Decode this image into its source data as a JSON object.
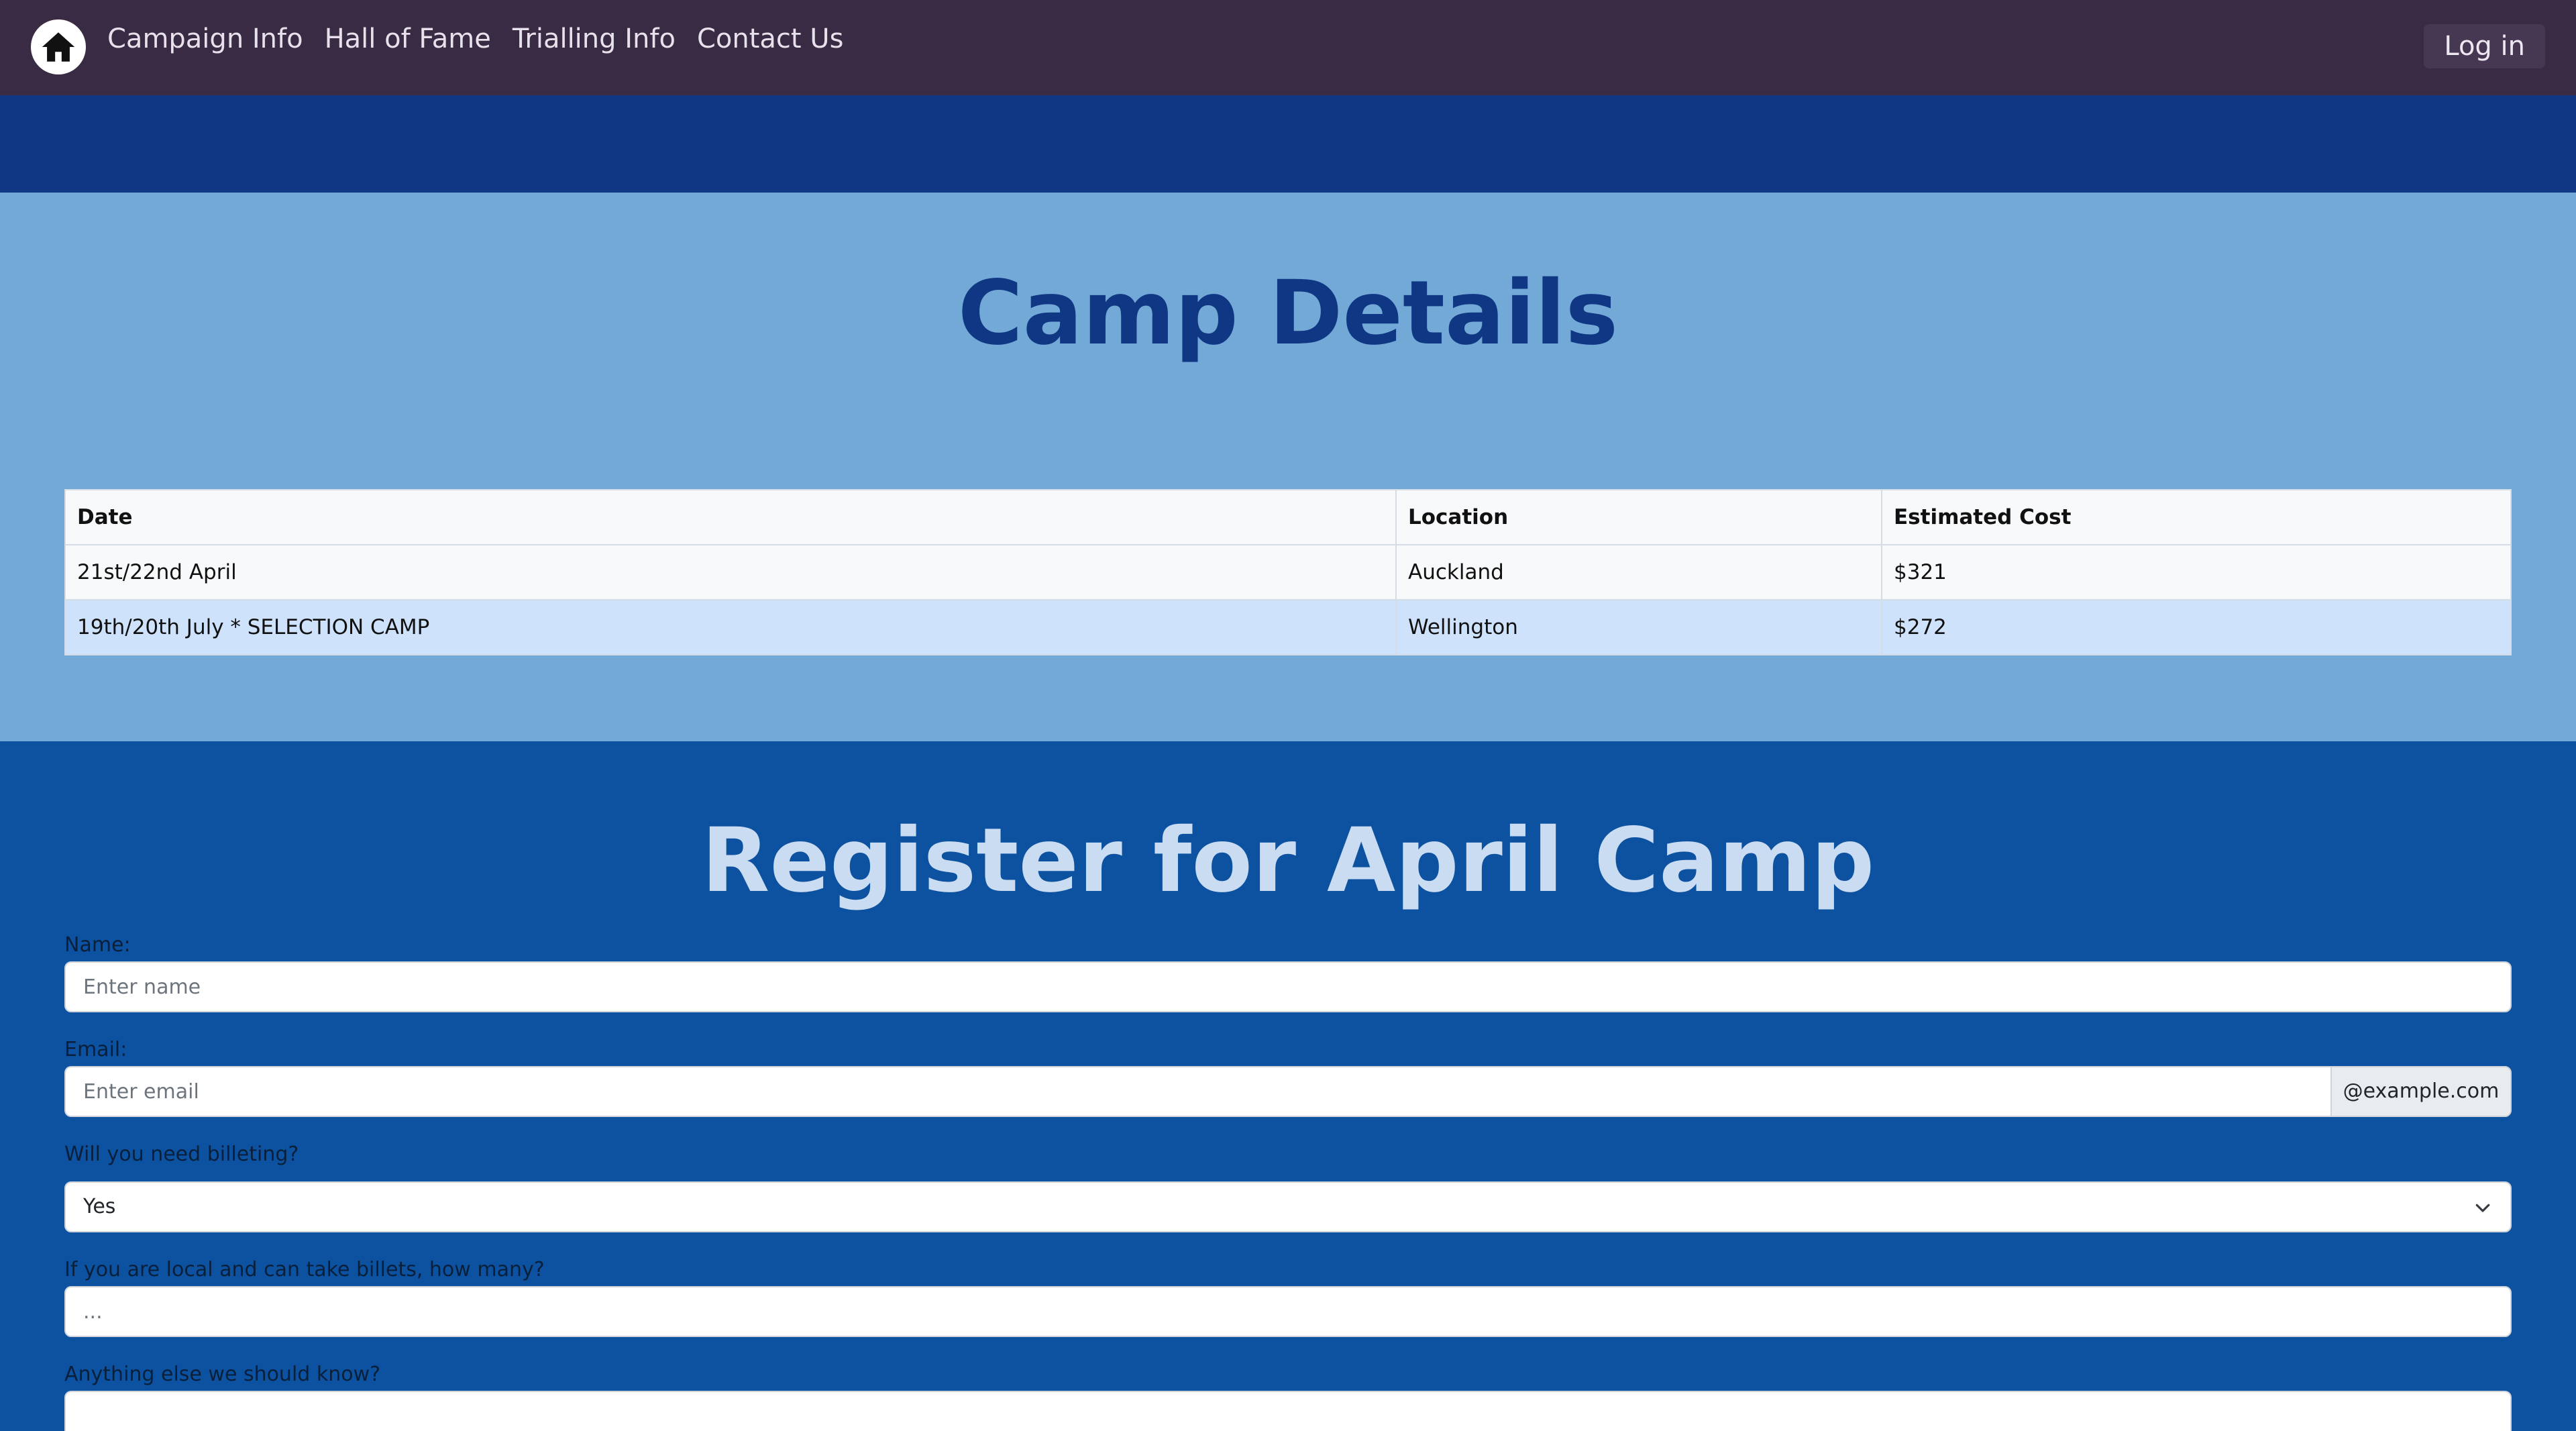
{
  "nav": {
    "home_icon": "house-icon",
    "links": [
      "Campaign Info",
      "Hall of Fame",
      "Trialling Info",
      "Contact Us"
    ],
    "login_label": "Log in"
  },
  "details": {
    "title": "Camp Details",
    "columns": [
      "Date",
      "Location",
      "Estimated Cost"
    ],
    "rows": [
      [
        "21st/22nd April",
        "Auckland",
        "$321"
      ],
      [
        "19th/20th July * SELECTION CAMP",
        "Wellington",
        "$272"
      ]
    ]
  },
  "register": {
    "title": "Register for April Camp",
    "name_label": "Name:",
    "name_placeholder": "Enter name",
    "email_label": "Email:",
    "email_placeholder": "Enter email",
    "email_suffix": "@example.com",
    "billeting_label": "Will you need billeting?",
    "billeting_value": "Yes",
    "billets_label": "If you are local and can take billets, how many?",
    "billets_placeholder": "...",
    "other_label": "Anything else we should know?"
  },
  "colors": {
    "navbar": "#3a2b45",
    "band": "#0f3784",
    "details_bg": "#72a9d6",
    "register_bg": "#0d52a0",
    "highlight_row": "#cfe2fb"
  }
}
